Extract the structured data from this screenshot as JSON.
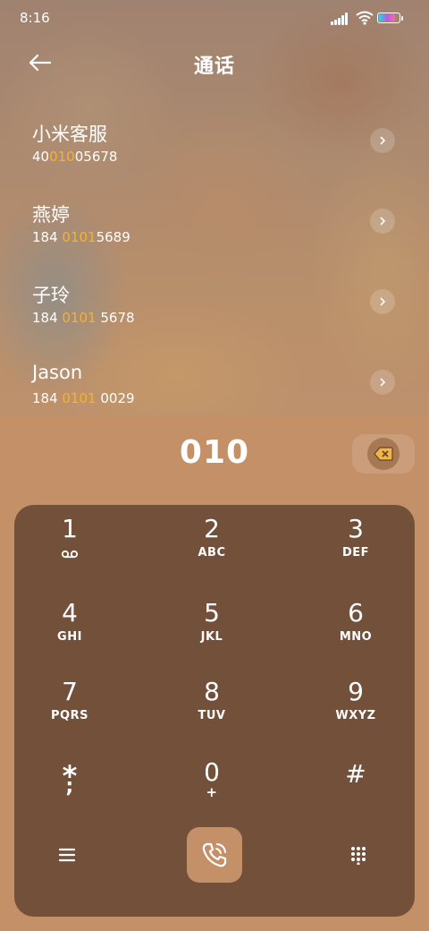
{
  "status": {
    "time": "8:16"
  },
  "header": {
    "title": "通话",
    "back_icon": "arrow-left-icon"
  },
  "results": [
    {
      "name": "小米客服",
      "number_pre": "40",
      "number_hl": "010",
      "number_post": "05678"
    },
    {
      "name": "燕婷",
      "number_pre": "184 ",
      "number_hl": "0101",
      "number_post": "5689"
    },
    {
      "name": "子玲",
      "number_pre": "184 ",
      "number_hl": "0101",
      "number_post": " 5678"
    },
    {
      "name": "Jason",
      "number_pre": "184 ",
      "number_hl": "0101",
      "number_post": " 0029"
    }
  ],
  "input": {
    "digits": "010"
  },
  "keypad": {
    "keys": [
      {
        "digit": "1",
        "letters": ""
      },
      {
        "digit": "2",
        "letters": "ABC"
      },
      {
        "digit": "3",
        "letters": "DEF"
      },
      {
        "digit": "4",
        "letters": "GHI"
      },
      {
        "digit": "5",
        "letters": "JKL"
      },
      {
        "digit": "6",
        "letters": "MNO"
      },
      {
        "digit": "7",
        "letters": "PQRS"
      },
      {
        "digit": "8",
        "letters": "TUV"
      },
      {
        "digit": "9",
        "letters": "WXYZ"
      },
      {
        "digit": "*",
        "letters": ";"
      },
      {
        "digit": "0",
        "letters": "+"
      },
      {
        "digit": "#",
        "letters": ""
      }
    ]
  },
  "colors": {
    "highlight": "#f4b232",
    "pad": "#73503a",
    "accent": "#c49068"
  }
}
